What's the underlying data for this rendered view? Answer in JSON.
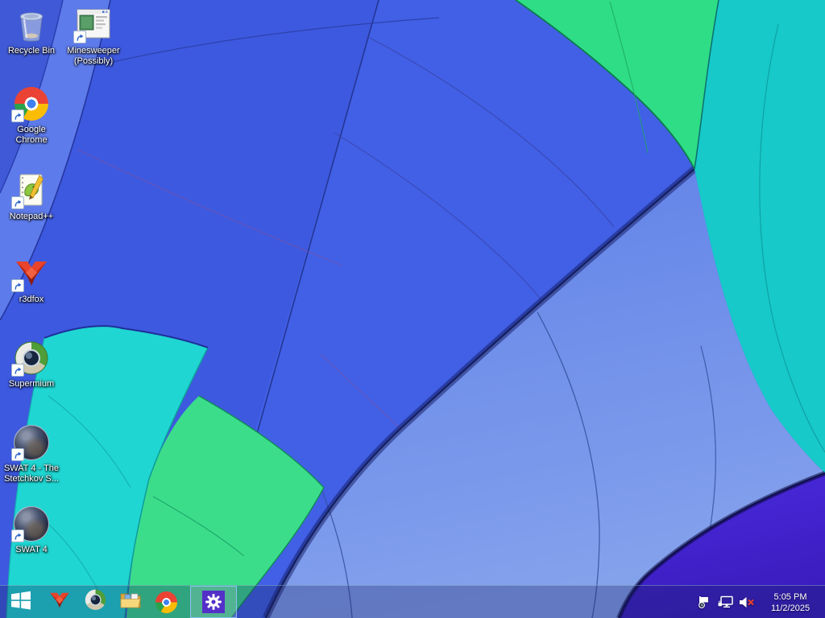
{
  "wallpaper": {
    "description": "close-up of multicolored hot air balloon canopy (Windows 8.1 default)",
    "colors": {
      "royal_blue": "#3D59DF",
      "light_blue_band": "#5D7BEA",
      "lower_light_gore": "#6687EA",
      "green_gore": "#2EDD85",
      "teal_right": "#17C9C9",
      "cyan_bottom_left": "#1FD6D2",
      "green_patch": "#3BDD8B",
      "indigo_corner": "#4326D6",
      "seam_line": "#243695"
    }
  },
  "desktop": {
    "icons": [
      {
        "glyph": "recycle-bin-icon",
        "label": "Recycle Bin",
        "shortcut": false
      },
      {
        "glyph": "minesweeper-window-icon",
        "label": "Minesweeper (Possibly)",
        "shortcut": true
      },
      {
        "glyph": "google-chrome-icon",
        "label": "Google Chrome",
        "shortcut": true
      },
      {
        "glyph": "notepad-plus-plus-icon",
        "label": "Notepad++",
        "shortcut": true
      },
      {
        "glyph": "r3dfox-icon",
        "label": "r3dfox",
        "shortcut": true
      },
      {
        "glyph": "supermium-icon",
        "label": "Supermium",
        "shortcut": true
      },
      {
        "glyph": "swat4-game-icon",
        "label": "SWAT 4 - The Stetchkov S...",
        "shortcut": true
      },
      {
        "glyph": "swat4-game-icon",
        "label": "SWAT 4",
        "shortcut": true
      }
    ]
  },
  "taskbar": {
    "start": {
      "name": "Start"
    },
    "pinned": [
      {
        "name": "r3dfox"
      },
      {
        "name": "Supermium"
      },
      {
        "name": "File Explorer"
      },
      {
        "name": "Google Chrome"
      }
    ],
    "settings": {
      "name": "Settings",
      "state": "active"
    },
    "tray": {
      "icons": [
        {
          "name": "Action Center"
        },
        {
          "name": "Network"
        },
        {
          "name": "Volume (muted)"
        }
      ],
      "time": "5:05 PM",
      "date": "11/2/2025"
    }
  }
}
